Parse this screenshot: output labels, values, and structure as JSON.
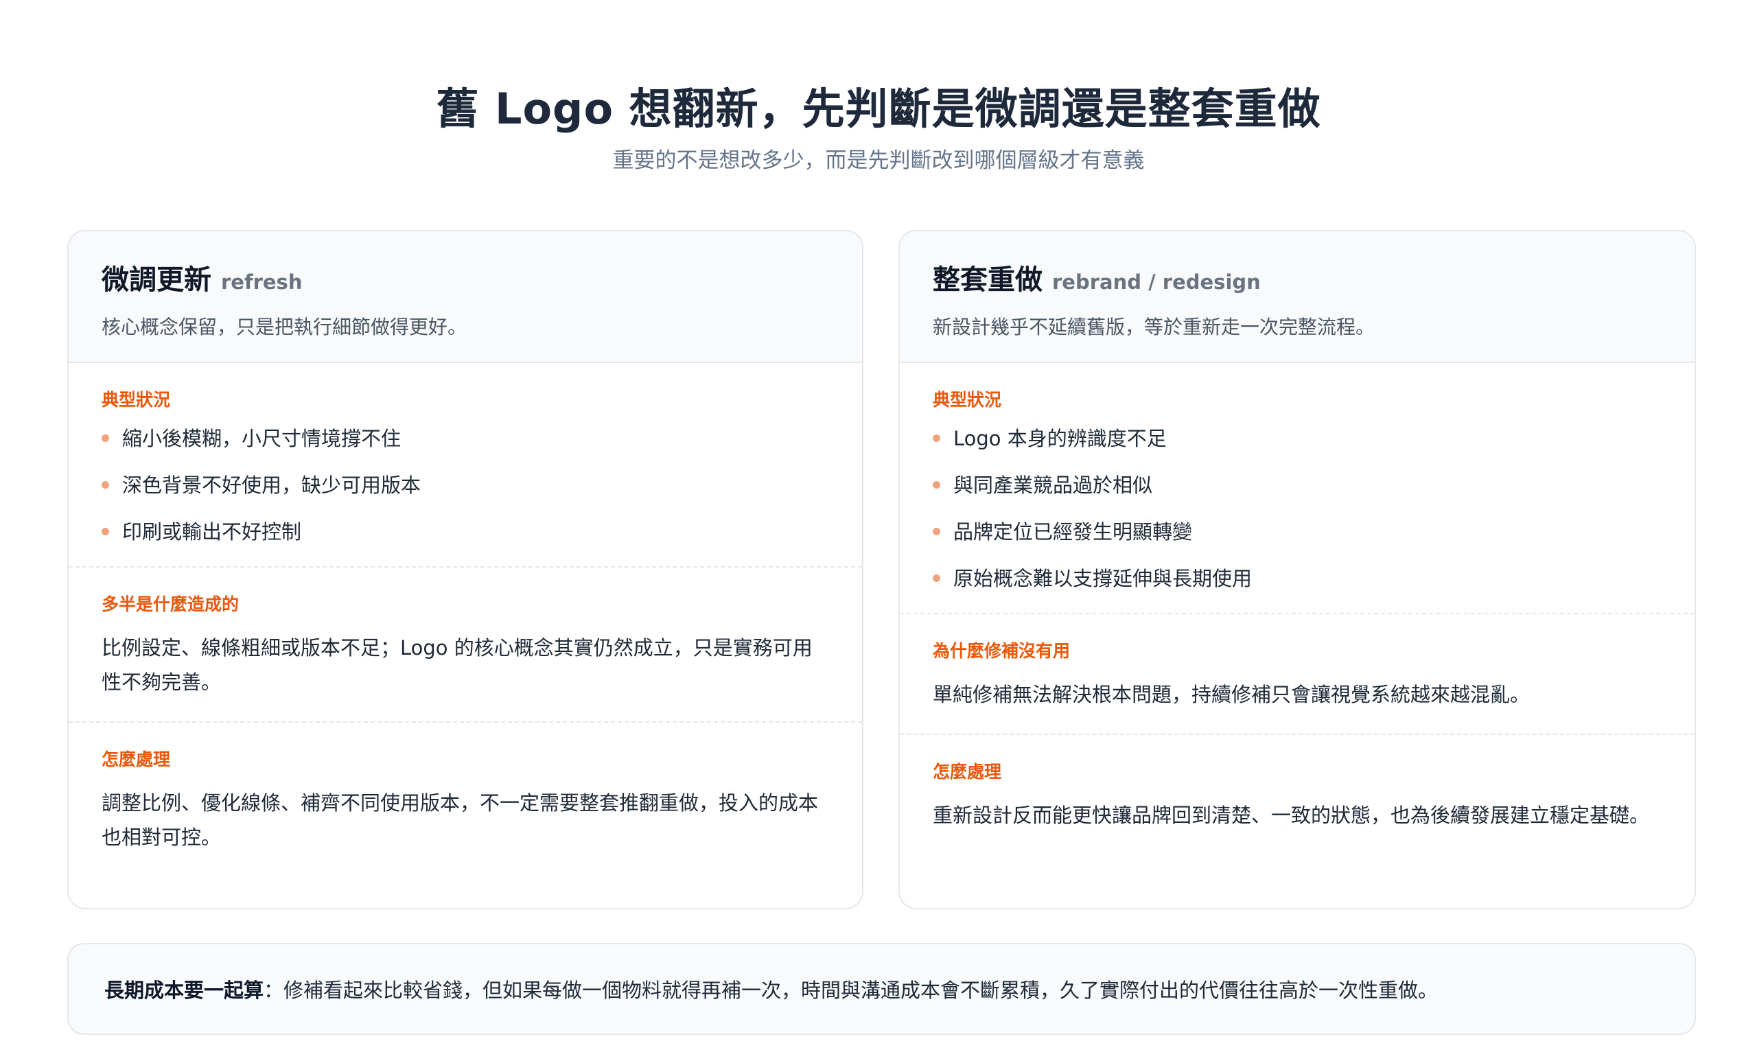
{
  "header": {
    "title": "舊 Logo 想翻新，先判斷是微調還是整套重做",
    "subtitle": "重要的不是想改多少，而是先判斷改到哪個層級才有意義"
  },
  "refresh_card": {
    "title": "微調更新",
    "tag": "refresh",
    "desc": "核心概念保留，只是把執行細節做得更好。",
    "situations_label": "典型狀況",
    "situations": [
      "縮小後模糊，小尺寸情境撐不住",
      "深色背景不好使用，缺少可用版本",
      "印刷或輸出不好控制"
    ],
    "cause_label": "多半是什麼造成的",
    "cause_text": "比例設定、線條粗細或版本不足；Logo 的核心概念其實仍然成立，只是實務可用性不夠完善。",
    "handle_label": "怎麼處理",
    "handle_text": "調整比例、優化線條、補齊不同使用版本，不一定需要整套推翻重做，投入的成本也相對可控。"
  },
  "rebrand_card": {
    "title": "整套重做",
    "tag": "rebrand / redesign",
    "desc": "新設計幾乎不延續舊版，等於重新走一次完整流程。",
    "situations_label": "典型狀況",
    "situations": [
      "Logo 本身的辨識度不足",
      "與同產業競品過於相似",
      "品牌定位已經發生明顯轉變",
      "原始概念難以支撐延伸與長期使用"
    ],
    "why_label": "為什麼修補沒有用",
    "why_text": "單純修補無法解決根本問題，持續修補只會讓視覺系統越來越混亂。",
    "handle_label": "怎麼處理",
    "handle_text": "重新設計反而能更快讓品牌回到清楚、一致的狀態，也為後續發展建立穩定基礎。"
  },
  "footer": {
    "strong": "長期成本要一起算",
    "text": "：修補看起來比較省錢，但如果每做一個物料就得再補一次，時間與溝通成本會不斷累積，久了實際付出的代價往往高於一次性重做。"
  },
  "colors": {
    "accent": "#ea580c",
    "bullet": "#f0a27c",
    "heading": "#1e293b",
    "muted": "#64748b",
    "card_head_bg": "#f8fafc",
    "border": "#e5e7eb"
  }
}
